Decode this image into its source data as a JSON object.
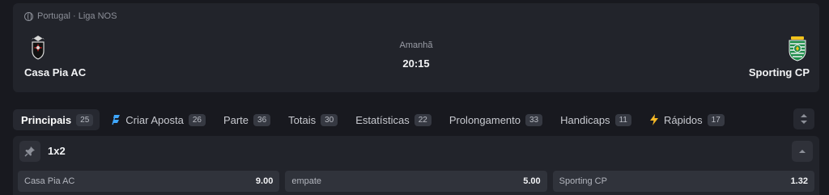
{
  "match": {
    "league": "Portugal · Liga NOS",
    "home_team": "Casa Pia AC",
    "away_team": "Sporting CP",
    "date_label": "Amanhã",
    "time": "20:15"
  },
  "tabs": [
    {
      "label": "Principais",
      "count": "25",
      "icon": ""
    },
    {
      "label": "Criar Aposta",
      "count": "26",
      "icon": "bet-builder-icon"
    },
    {
      "label": "Parte",
      "count": "36",
      "icon": ""
    },
    {
      "label": "Totais",
      "count": "30",
      "icon": ""
    },
    {
      "label": "Estatísticas",
      "count": "22",
      "icon": ""
    },
    {
      "label": "Prolongamento",
      "count": "33",
      "icon": ""
    },
    {
      "label": "Handicaps",
      "count": "11",
      "icon": ""
    },
    {
      "label": "Rápidos",
      "count": "17",
      "icon": "lightning-icon"
    }
  ],
  "market": {
    "title": "1x2",
    "odds": [
      {
        "label": "Casa Pia AC",
        "value": "9.00"
      },
      {
        "label": "empate",
        "value": "5.00"
      },
      {
        "label": "Sporting CP",
        "value": "1.32"
      }
    ]
  },
  "colors": {
    "background": "#18191f",
    "card": "#22242b",
    "odds_button": "#30333b",
    "accent_blue": "#3fa7ff",
    "accent_yellow": "#f5b826",
    "sporting_green": "#1e8c4a",
    "casa_pia_red": "#c42b2b"
  }
}
